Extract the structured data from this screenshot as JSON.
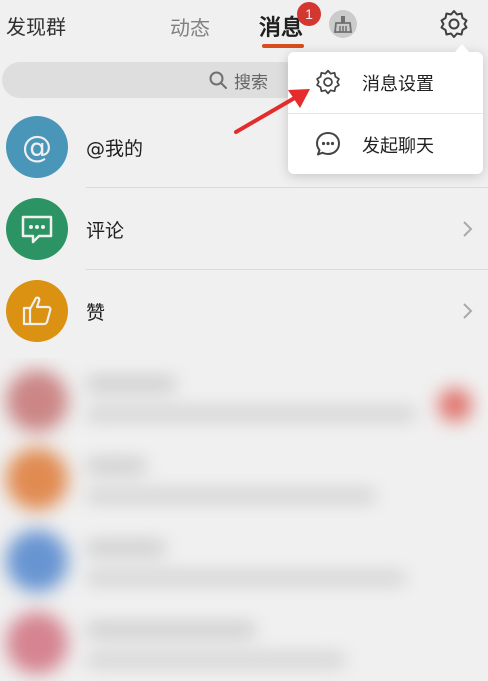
{
  "header": {
    "left_title": "发现群",
    "tabs": [
      {
        "label": "动态",
        "active": false
      },
      {
        "label": "消息",
        "active": true,
        "badge": "1"
      }
    ],
    "icons": [
      "broom-icon",
      "gear-icon"
    ],
    "accent_color": "#e6521f",
    "badge_color": "#e23b34"
  },
  "search": {
    "placeholder": "搜索"
  },
  "list": [
    {
      "label": "@我的",
      "icon": "at-icon",
      "color": "#4fa0c5",
      "has_chevron": false
    },
    {
      "label": "评论",
      "icon": "comment-icon",
      "color": "#2f9d6b",
      "has_chevron": true
    },
    {
      "label": "赞",
      "icon": "thumbs-up-icon",
      "color": "#e99b14",
      "has_chevron": true
    }
  ],
  "popup": {
    "items": [
      {
        "label": "消息设置",
        "icon": "gear-icon"
      },
      {
        "label": "发起聊天",
        "icon": "chat-bubble-icon"
      }
    ]
  },
  "annotation": {
    "type": "arrow",
    "color": "#e52b2b",
    "points_to": "消息设置"
  }
}
